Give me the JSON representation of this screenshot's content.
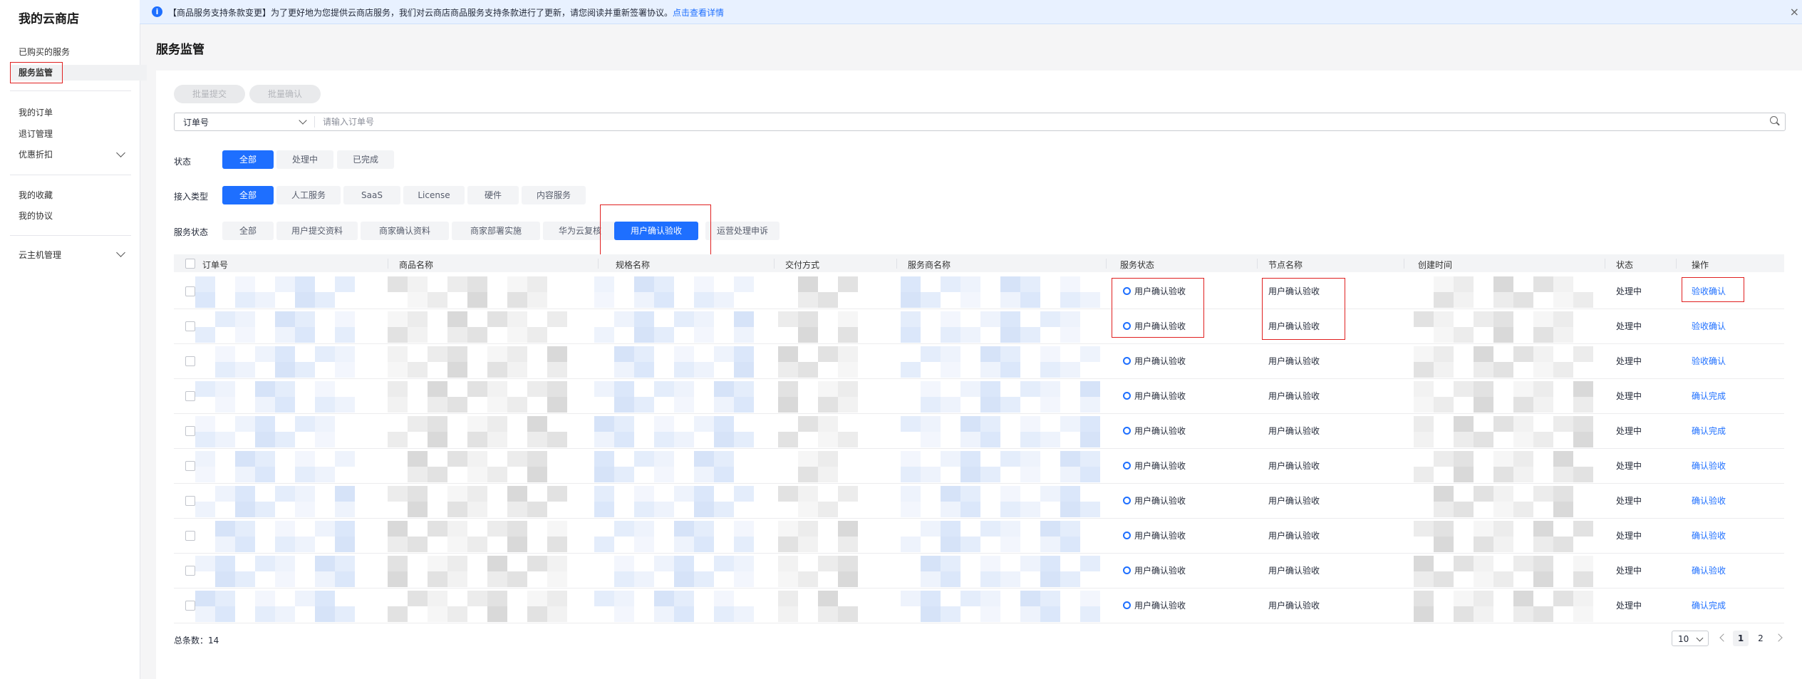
{
  "sidebar": {
    "title": "我的云商店",
    "items": [
      {
        "label": "已购买的服务"
      },
      {
        "label": "服务监管"
      },
      {
        "label": "我的订单"
      },
      {
        "label": "退订管理"
      },
      {
        "label": "优惠折扣"
      },
      {
        "label": "我的收藏"
      },
      {
        "label": "我的协议"
      },
      {
        "label": "云主机管理"
      }
    ]
  },
  "banner": {
    "text": "【商品服务支持条款变更】为了更好地为您提供云商店服务，我们对云商店商品服务支持条款进行了更新，请您阅读并重新签署协议。",
    "link": "点击查看详情",
    "close": "×"
  },
  "page": {
    "title": "服务监管"
  },
  "actions": {
    "batch_submit": "批量提交",
    "batch_confirm": "批量确认"
  },
  "search": {
    "field": "订单号",
    "placeholder": "请输入订单号"
  },
  "filters": {
    "status_label": "状态",
    "status_options": [
      "全部",
      "处理中",
      "已完成"
    ],
    "access_label": "接入类型",
    "access_options": [
      "全部",
      "人工服务",
      "SaaS",
      "License",
      "硬件",
      "内容服务"
    ],
    "service_status_label": "服务状态",
    "service_status_options": [
      "全部",
      "用户提交资料",
      "商家确认资料",
      "商家部署实施",
      "华为云复核",
      "用户确认验收",
      "运营处理申诉"
    ]
  },
  "table": {
    "columns": [
      "订单号",
      "商品名称",
      "规格名称",
      "交付方式",
      "服务商名称",
      "服务状态",
      "节点名称",
      "创建时间",
      "状态",
      "操作"
    ],
    "rows": [
      {
        "service_status": "用户确认验收",
        "node": "用户确认验收",
        "status": "处理中",
        "action": "验收确认"
      },
      {
        "service_status": "用户确认验收",
        "node": "用户确认验收",
        "status": "处理中",
        "action": "验收确认"
      },
      {
        "service_status": "用户确认验收",
        "node": "用户确认验收",
        "status": "处理中",
        "action": "验收确认"
      },
      {
        "service_status": "用户确认验收",
        "node": "用户确认验收",
        "status": "处理中",
        "action": "确认完成"
      },
      {
        "service_status": "用户确认验收",
        "node": "用户确认验收",
        "status": "处理中",
        "action": "确认完成"
      },
      {
        "service_status": "用户确认验收",
        "node": "用户确认验收",
        "status": "处理中",
        "action": "确认验收"
      },
      {
        "service_status": "用户确认验收",
        "node": "用户确认验收",
        "status": "处理中",
        "action": "确认验收"
      },
      {
        "service_status": "用户确认验收",
        "node": "用户确认验收",
        "status": "处理中",
        "action": "确认验收"
      },
      {
        "service_status": "用户确认验收",
        "node": "用户确认验收",
        "status": "处理中",
        "action": "确认验收"
      },
      {
        "service_status": "用户确认验收",
        "node": "用户确认验收",
        "status": "处理中",
        "action": "确认完成"
      }
    ]
  },
  "footer": {
    "total_label": "总条数：",
    "total": "14",
    "page_size": "10",
    "pages": [
      "1",
      "2"
    ]
  },
  "colors": {
    "accent": "#1e6fff",
    "highlight_border": "#e02020"
  }
}
